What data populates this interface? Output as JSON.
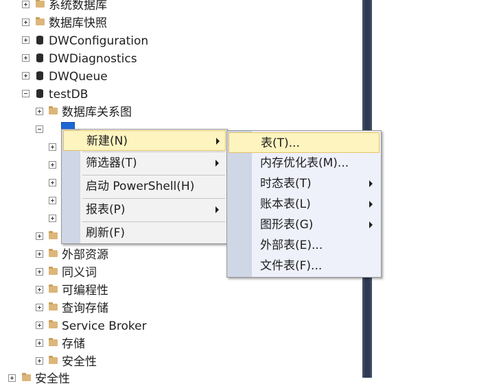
{
  "tree": {
    "rows": [
      {
        "label": "系统数据库",
        "icon": "folder-icon",
        "expander": "plus"
      },
      {
        "label": "数据库快照",
        "icon": "folder-icon",
        "expander": "plus"
      },
      {
        "label": "DWConfiguration",
        "icon": "database-icon",
        "expander": "plus"
      },
      {
        "label": "DWDiagnostics",
        "icon": "database-icon",
        "expander": "plus"
      },
      {
        "label": "DWQueue",
        "icon": "database-icon",
        "expander": "plus"
      },
      {
        "label": "testDB",
        "icon": "database-icon",
        "expander": "minus"
      },
      {
        "label": "数据库关系图",
        "icon": "folder-icon",
        "expander": "plus"
      },
      {
        "label": "外部资源",
        "icon": "folder-icon",
        "expander": "plus"
      },
      {
        "label": "同义词",
        "icon": "folder-icon",
        "expander": "plus"
      },
      {
        "label": "可编程性",
        "icon": "folder-icon",
        "expander": "plus"
      },
      {
        "label": "查询存储",
        "icon": "folder-icon",
        "expander": "plus"
      },
      {
        "label": "Service Broker",
        "icon": "folder-icon",
        "expander": "plus"
      },
      {
        "label": "存储",
        "icon": "folder-icon",
        "expander": "plus"
      },
      {
        "label": "安全性",
        "icon": "folder-icon",
        "expander": "plus"
      },
      {
        "label": "安全性",
        "icon": "folder-icon",
        "expander": "plus"
      }
    ]
  },
  "context_menu": {
    "items": [
      {
        "label": "新建(N)",
        "has_submenu": true,
        "highlighted": true
      },
      {
        "label": "筛选器(T)",
        "has_submenu": true
      },
      {
        "label": "启动 PowerShell(H)",
        "has_submenu": false
      },
      {
        "label": "报表(P)",
        "has_submenu": true
      },
      {
        "label": "刷新(F)",
        "has_submenu": false
      }
    ]
  },
  "submenu": {
    "items": [
      {
        "label": "表(T)...",
        "has_submenu": false,
        "highlighted": true
      },
      {
        "label": "内存优化表(M)...",
        "has_submenu": false
      },
      {
        "label": "时态表(T)",
        "has_submenu": true
      },
      {
        "label": "账本表(L)",
        "has_submenu": true
      },
      {
        "label": "图形表(G)",
        "has_submenu": true
      },
      {
        "label": "外部表(E)...",
        "has_submenu": false
      },
      {
        "label": "文件表(F)...",
        "has_submenu": false
      }
    ]
  },
  "colors": {
    "menu_highlight": "#fdf4bf",
    "menu_gutter": "#cfd6e5",
    "selection": "#1c67d4",
    "scrollbar": "#3e4b66"
  }
}
